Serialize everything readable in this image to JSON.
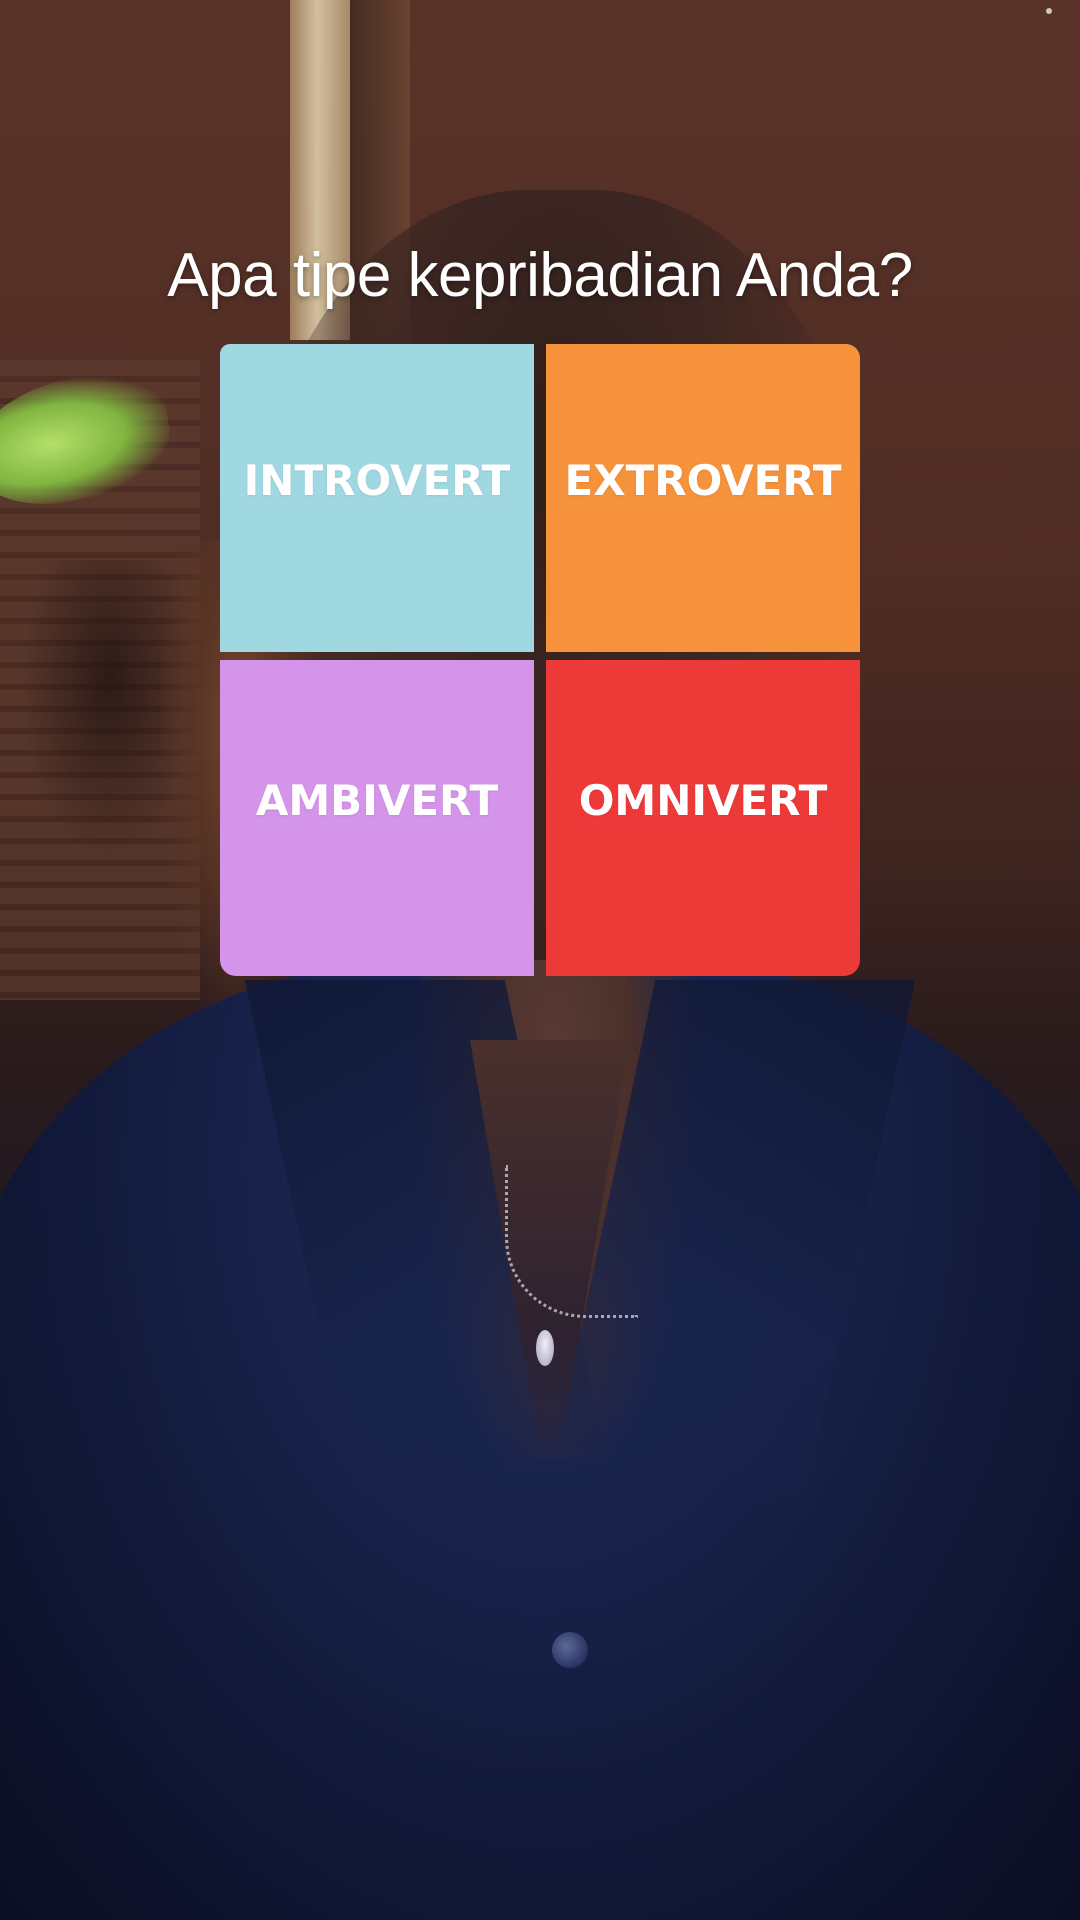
{
  "question": "Apa tipe kepribadian Anda?",
  "options": [
    {
      "label": "INTROVERT",
      "color": "#a0d8e2"
    },
    {
      "label": "EXTROVERT",
      "color": "#f6923c"
    },
    {
      "label": "AMBIVERT",
      "color": "#d494e9"
    },
    {
      "label": "OMNIVERT",
      "color": "#ee3939"
    }
  ]
}
